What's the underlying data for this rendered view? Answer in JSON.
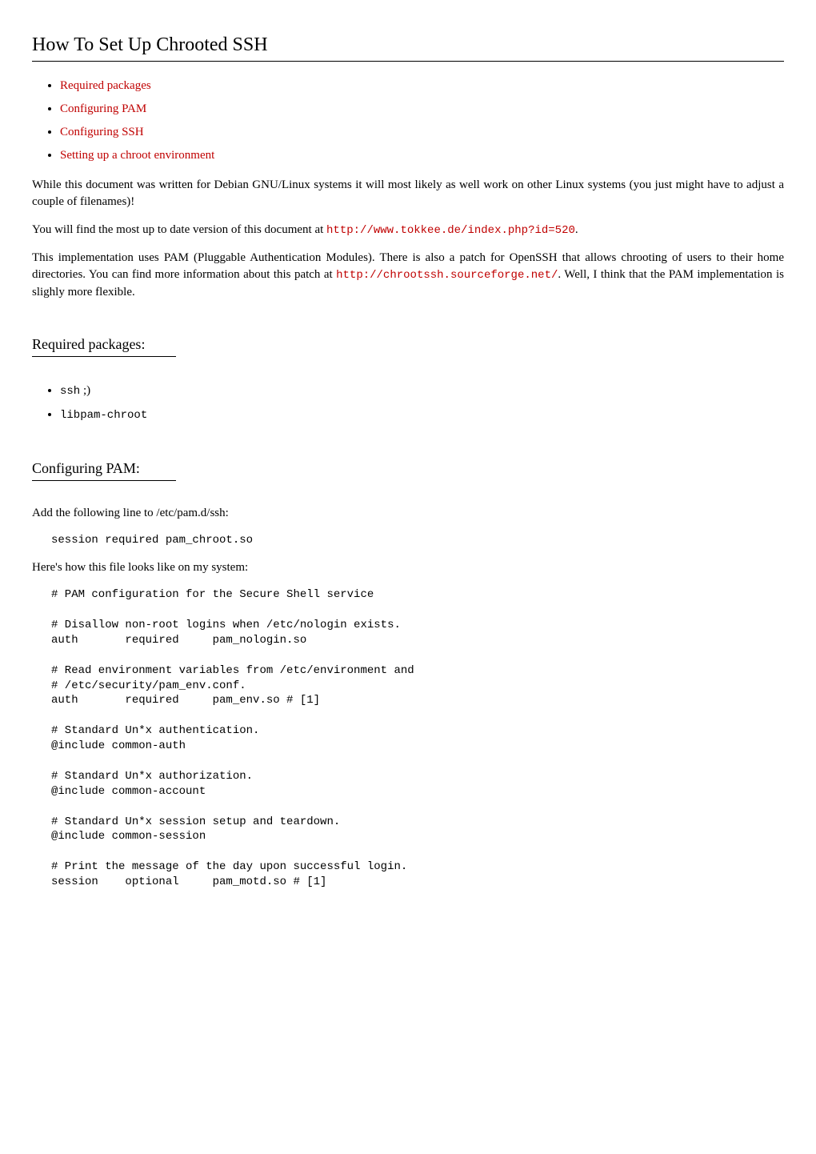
{
  "title": "How To Set Up Chrooted SSH",
  "toc": {
    "items": [
      {
        "label": "Required packages"
      },
      {
        "label": "Configuring PAM"
      },
      {
        "label": "Configuring SSH"
      },
      {
        "label": "Setting up a chroot environment"
      }
    ]
  },
  "intro": {
    "p1": "While this document was written for Debian GNU/Linux systems it will most likely as well work on other Linux systems (you just might have to adjust a couple of filenames)!",
    "p2_pre": "You will find the most up to date version of this document at ",
    "p2_link": "http://www.tokkee.de/index.php?id=520",
    "p2_post": ".",
    "p3_pre": "This implementation uses PAM (Pluggable Authentication Modules). There is also a patch for OpenSSH that allows chrooting of users to their home directories. You can find more information about this patch at ",
    "p3_link": "http://chrootssh.sourceforge.net/",
    "p3_post": ". Well, I think that the PAM implementation is slighly more flexible."
  },
  "required": {
    "heading": "Required packages:",
    "items": [
      {
        "tt": "ssh",
        "tail": " ;)"
      },
      {
        "tt": "libpam-chroot",
        "tail": ""
      }
    ]
  },
  "pam": {
    "heading": "Configuring PAM:",
    "p1": "Add the following line to /etc/pam.d/ssh:",
    "code1": "session required pam_chroot.so",
    "p2": "Here's how this file looks like on my system:",
    "code2": "# PAM configuration for the Secure Shell service\n\n# Disallow non-root logins when /etc/nologin exists.\nauth       required     pam_nologin.so\n\n# Read environment variables from /etc/environment and\n# /etc/security/pam_env.conf.\nauth       required     pam_env.so # [1]\n\n# Standard Un*x authentication.\n@include common-auth\n\n# Standard Un*x authorization.\n@include common-account\n\n# Standard Un*x session setup and teardown.\n@include common-session\n\n# Print the message of the day upon successful login.\nsession    optional     pam_motd.so # [1]"
  }
}
